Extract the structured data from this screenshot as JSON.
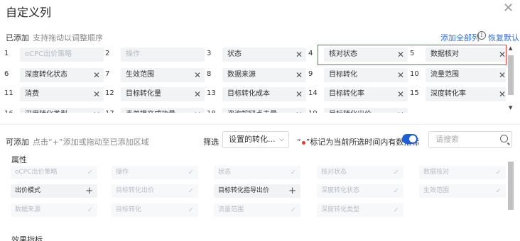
{
  "dialog": {
    "title": "自定义列",
    "close_glyph": "✕"
  },
  "added": {
    "label": "已添加",
    "hint": "支持拖动以调整顺序",
    "add_all": "添加全部列",
    "restore": "恢复默认",
    "items": [
      {
        "num": "1",
        "label": "oCPC出价策略",
        "removable": false
      },
      {
        "num": "2",
        "label": "操作",
        "removable": false
      },
      {
        "num": "3",
        "label": "状态",
        "removable": true
      },
      {
        "num": "4",
        "label": "核对状态",
        "removable": true
      },
      {
        "num": "5",
        "label": "数据核对",
        "removable": true
      },
      {
        "num": "6",
        "label": "深度转化状态",
        "removable": true
      },
      {
        "num": "7",
        "label": "生效范围",
        "removable": true
      },
      {
        "num": "8",
        "label": "数据来源",
        "removable": true
      },
      {
        "num": "9",
        "label": "目标转化",
        "removable": true
      },
      {
        "num": "10",
        "label": "流量范围",
        "removable": true
      },
      {
        "num": "11",
        "label": "消费",
        "removable": true
      },
      {
        "num": "12",
        "label": "目标转化量",
        "removable": true
      },
      {
        "num": "13",
        "label": "目标转化成本",
        "removable": true
      },
      {
        "num": "14",
        "label": "目标转化率",
        "removable": true
      },
      {
        "num": "15",
        "label": "深度转化率",
        "removable": true
      },
      {
        "num": "16",
        "label": "深度转化类型",
        "removable": true
      },
      {
        "num": "17",
        "label": "表单提交成功量",
        "removable": true
      },
      {
        "num": "18",
        "label": "咨询按钮点击量",
        "removable": true
      },
      {
        "num": "19",
        "label": "目标转化出价",
        "removable": true
      }
    ]
  },
  "available": {
    "label": "可添加",
    "hint": "点击“+”添加或拖动至已添加区域",
    "filter_label": "筛选",
    "filter_value": "设置的转化...",
    "mark_prefix": "“",
    "mark_suffix": "”标记为当前所选时间内有数指标",
    "toggle_on": true,
    "search_placeholder": "请搜索",
    "sections": [
      {
        "title": "属性",
        "items": [
          {
            "label": "oCPC出价策略",
            "state": "added"
          },
          {
            "label": "操作",
            "state": "added"
          },
          {
            "label": "状态",
            "state": "added"
          },
          {
            "label": "核对状态",
            "state": "added"
          },
          {
            "label": "数据核对",
            "state": "added"
          },
          {
            "label": "出价模式",
            "state": "addable"
          },
          {
            "label": "目标转化出价",
            "state": "added"
          },
          {
            "label": "目标转化指导出价",
            "state": "addable"
          },
          {
            "label": "深度转化状态",
            "state": "added"
          },
          {
            "label": "生效范围",
            "state": "added"
          },
          {
            "label": "数据来源",
            "state": "added"
          },
          {
            "label": "目标转化",
            "state": "added"
          },
          {
            "label": "流量范围",
            "state": "added"
          },
          {
            "label": "深度转化类型",
            "state": "added"
          }
        ]
      },
      {
        "title": "效果指标",
        "items": []
      }
    ]
  },
  "icons": {
    "remove": "✕",
    "added_check": "✓",
    "add_plus": "+",
    "info": "i",
    "chevron_down": "⌵",
    "scroll_up": "▲",
    "scroll_down": "▼"
  }
}
